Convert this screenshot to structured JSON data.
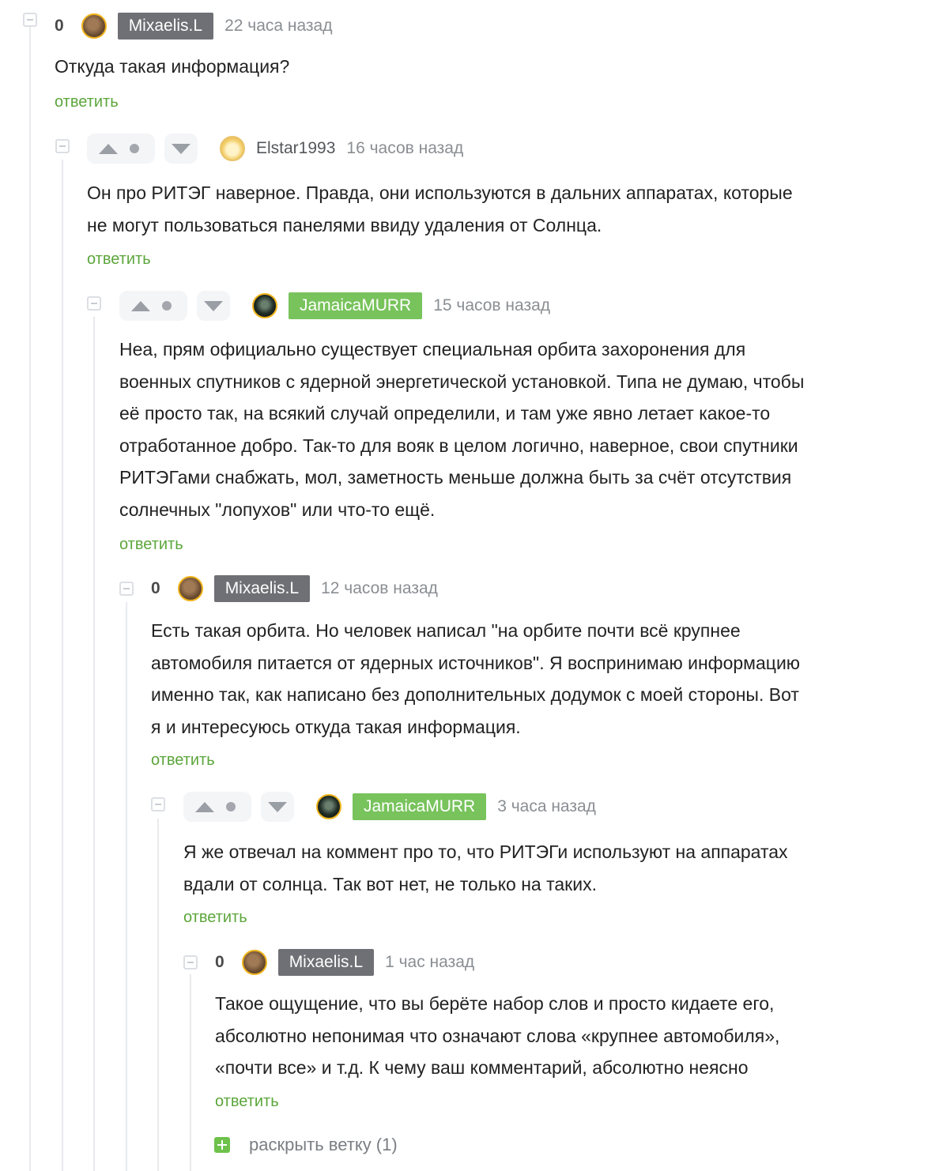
{
  "comments": [
    {
      "rating": "0",
      "user": "Mixaelis.L",
      "time": "22 часа назад",
      "lines": [
        "Откуда такая информация?"
      ],
      "reply_label": "ответить"
    },
    {
      "user": "Elstar1993",
      "time": "16 часов назад",
      "lines": [
        "Он про РИТЭГ наверное. Правда, они используются в дальних аппаратах, которые",
        "не могут пользоваться панелями ввиду удаления от Солнца."
      ],
      "reply_label": "ответить"
    },
    {
      "user": "JamaicaMURR",
      "time": "15 часов назад",
      "lines": [
        "Неа, прям официально существует специальная орбита захоронения для",
        "военных спутников с ядерной энергетической установкой. Типа не думаю, чтобы",
        "её просто так, на всякий случай определили, и там уже явно летает какое-то",
        "отработанное добро. Так-то для вояк в целом логично, наверное, свои спутники",
        "РИТЭГами снабжать, мол, заметность меньше должна быть за счёт отсутствия",
        "солнечных \"лопухов\" или что-то ещё."
      ],
      "reply_label": "ответить"
    },
    {
      "rating": "0",
      "user": "Mixaelis.L",
      "time": "12 часов назад",
      "lines": [
        "Есть такая орбита. Но человек написал \"на орбите почти всё крупнее",
        "автомобиля питается от ядерных источников\". Я воспринимаю информацию",
        "именно так, как написано без дополнительных додумок с моей стороны. Вот",
        "я и интересуюсь откуда такая информация."
      ],
      "reply_label": "ответить"
    },
    {
      "user": "JamaicaMURR",
      "time": "3 часа назад",
      "lines": [
        "Я же отвечал на коммент про то, что РИТЭГи используют на аппаратах",
        "вдали от солнца. Так вот нет, не только на таких."
      ],
      "reply_label": "ответить"
    },
    {
      "rating": "0",
      "user": "Mixaelis.L",
      "time": "1 час назад",
      "lines": [
        "Такое ощущение, что вы берёте набор слов и просто кидаете его,",
        "абсолютно непонимая что означают слова «крупнее автомобиля»,",
        "«почти все» и т.д. К чему ваш комментарий, абсолютно неясно"
      ],
      "reply_label": "ответить"
    }
  ],
  "expand_branch": "раскрыть ветку (1)",
  "icons": [
    "collapse-icon",
    "upvote-icon",
    "vote-dot-icon",
    "downvote-icon",
    "avatar-icon",
    "expand-plus-icon"
  ],
  "colors": {
    "accent_green": "#78c35c",
    "badge_dark": "#6f7075",
    "reply_green": "#5ca63b"
  }
}
